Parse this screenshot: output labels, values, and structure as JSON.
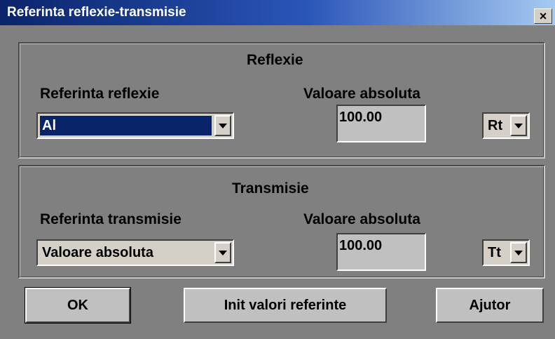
{
  "window": {
    "title": "Referinta reflexie-transmisie",
    "close_label": "×"
  },
  "reflexie": {
    "heading": "Reflexie",
    "ref_label": "Referinta reflexie",
    "ref_value": "Al",
    "abs_label": "Valoare absoluta",
    "abs_value": "100.00",
    "unit_value": "Rt"
  },
  "transmisie": {
    "heading": "Transmisie",
    "ref_label": "Referinta transmisie",
    "ref_value": "Valoare absoluta",
    "abs_label": "Valoare absoluta",
    "abs_value": "100.00",
    "unit_value": "Tt"
  },
  "buttons": {
    "ok": "OK",
    "init": "Init valori referinte",
    "help": "Ajutor"
  },
  "colors": {
    "title_bar": "#0a246a",
    "dialog_bg": "#808080",
    "selection": "#0a246a"
  }
}
